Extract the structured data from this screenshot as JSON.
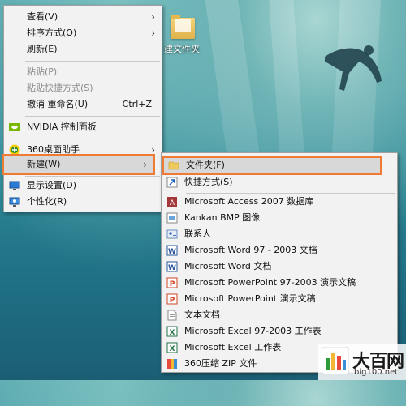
{
  "desktop": {
    "icon_label": "建文件夹"
  },
  "context_menu": {
    "items": [
      {
        "label": "查看(V)",
        "arrow": "›"
      },
      {
        "label": "排序方式(O)",
        "arrow": "›"
      },
      {
        "label": "刷新(E)"
      },
      {
        "label": "粘贴(P)"
      },
      {
        "label": "粘贴快捷方式(S)"
      },
      {
        "label": "撤消 重命名(U)",
        "shortcut": "Ctrl+Z"
      },
      {
        "label": "NVIDIA 控制面板",
        "icon": "nvidia-icon"
      },
      {
        "label": "360桌面助手",
        "icon": "360-icon",
        "arrow": "›"
      },
      {
        "label": "新建(W)",
        "arrow": "›"
      },
      {
        "label": "显示设置(D)",
        "icon": "display-settings-icon"
      },
      {
        "label": "个性化(R)",
        "icon": "personalize-icon"
      }
    ]
  },
  "new_submenu": {
    "items": [
      {
        "label": "文件夹(F)",
        "icon": "folder-icon"
      },
      {
        "label": "快捷方式(S)",
        "icon": "shortcut-icon"
      },
      {
        "label": "Microsoft Access 2007 数据库",
        "icon": "access-icon"
      },
      {
        "label": "Kankan BMP 图像",
        "icon": "bmp-icon"
      },
      {
        "label": "联系人",
        "icon": "contact-icon"
      },
      {
        "label": "Microsoft Word 97 - 2003 文档",
        "icon": "word-icon"
      },
      {
        "label": "Microsoft Word 文档",
        "icon": "word-icon"
      },
      {
        "label": "Microsoft PowerPoint 97-2003 演示文稿",
        "icon": "powerpoint-icon"
      },
      {
        "label": "Microsoft PowerPoint 演示文稿",
        "icon": "powerpoint-icon"
      },
      {
        "label": "文本文档",
        "icon": "text-document-icon"
      },
      {
        "label": "Microsoft Excel 97-2003 工作表",
        "icon": "excel-icon"
      },
      {
        "label": "Microsoft Excel 工作表",
        "icon": "excel-icon"
      },
      {
        "label": "360压缩 ZIP 文件",
        "icon": "zip-icon"
      }
    ]
  },
  "watermark": {
    "title": "大百网",
    "url": "big100.net"
  },
  "colors": {
    "highlight_border": "#ee7a34",
    "menu_bg": "#f2f2f2"
  }
}
